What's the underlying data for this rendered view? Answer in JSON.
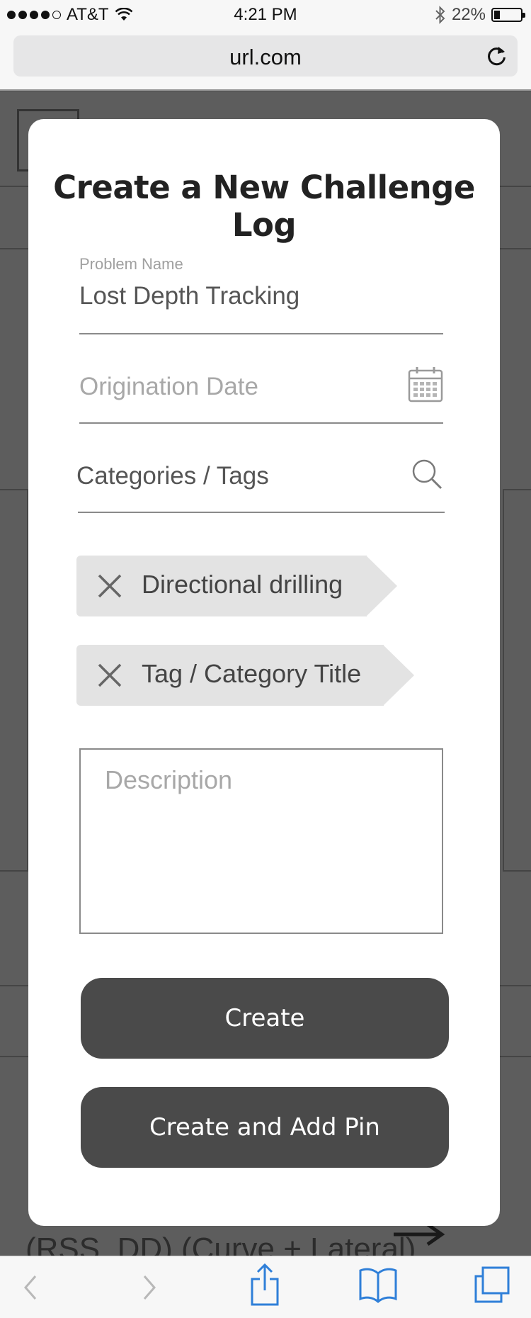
{
  "status_bar": {
    "carrier": "AT&T",
    "time": "4:21 PM",
    "battery": "22%",
    "battery_level": 0.22,
    "icons": [
      "signal-dots-icon",
      "wifi-icon",
      "bluetooth-icon",
      "battery-icon"
    ]
  },
  "browser": {
    "url": "url.com",
    "reload_icon": "reload-icon"
  },
  "background_page": {
    "bottom_text": "(RSS, DD) (Curve + Lateral)"
  },
  "modal": {
    "title": "Create a New Challenge Log",
    "problem_name": {
      "label": "Problem Name",
      "value": "Lost Depth Tracking"
    },
    "origination_date": {
      "placeholder": "Origination Date",
      "icon": "calendar-icon"
    },
    "categories": {
      "text": "Categories / Tags",
      "icon": "search-icon"
    },
    "tags": [
      {
        "label": "Directional drilling",
        "remove_icon": "close-icon"
      },
      {
        "label": "Tag / Category Title",
        "remove_icon": "close-icon"
      }
    ],
    "description": {
      "placeholder": "Description"
    },
    "buttons": {
      "create": "Create",
      "create_and_add_pin": "Create and Add Pin"
    }
  },
  "toolbar": {
    "items": [
      "back-icon",
      "forward-icon",
      "share-icon",
      "bookmarks-icon",
      "tabs-icon"
    ],
    "accent_color": "#2f7fd8",
    "disabled_color": "#b8b8b8"
  }
}
